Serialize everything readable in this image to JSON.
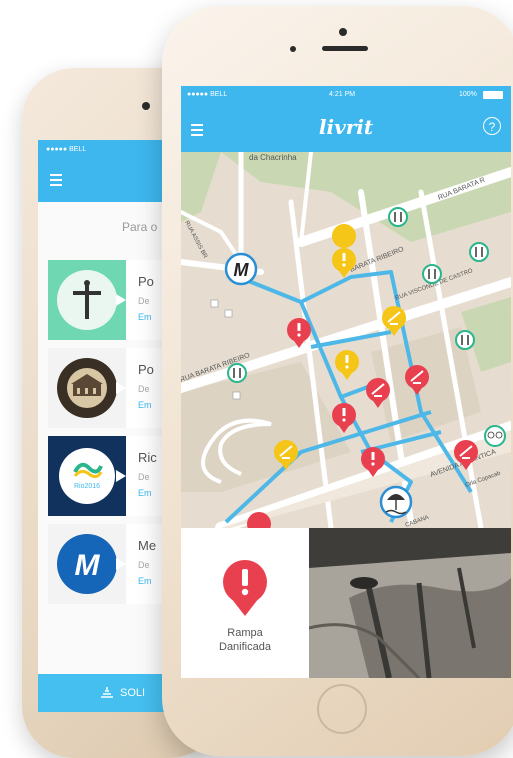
{
  "back_phone": {
    "status": "●●●●● BELL",
    "subtitle": "Para o",
    "items": [
      {
        "title": "Po",
        "line2": "De",
        "link": "Em"
      },
      {
        "title": "Po",
        "line2": "De",
        "link": "Em"
      },
      {
        "title": "Ric",
        "line2": "De",
        "link": "Em"
      },
      {
        "title": "Me",
        "line2": "De",
        "link": "Em"
      }
    ],
    "bottom_label": "SOLI"
  },
  "status_bar": {
    "carrier": "●●●●● BELL",
    "time": "4:21 PM",
    "battery": "100%"
  },
  "app": {
    "title": "livrit",
    "help": "?"
  },
  "map_labels": {
    "top": "da Chacrinha",
    "rua_barata_top": "RUA BARATA R",
    "barata_ribeiro": "BARATA RIBEIRO",
    "rua_assis": "RUA ASSIS BR",
    "viveiros": "RUA VISCONDE DE CASTRO",
    "rua_barata_left": "RUA BARATA RIBEIRO",
    "atlantica": "AVENIDA ATLÂNTICA",
    "orla": "Orla Copacab",
    "copacabana": "CABANA"
  },
  "detail": {
    "label_line1": "Rampa",
    "label_line2": "Danificada"
  },
  "colors": {
    "accent": "#3db7ee",
    "danger": "#e8404f",
    "warning": "#f5c518",
    "venue": "#2bb58c"
  }
}
